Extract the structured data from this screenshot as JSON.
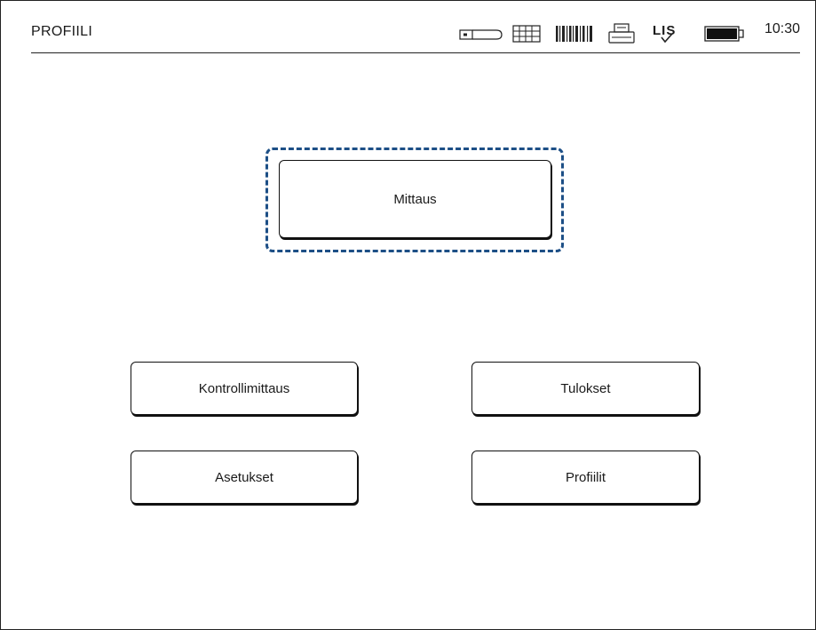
{
  "header": {
    "title": "PROFIILI",
    "time": "10:30",
    "lis_label": "LIS",
    "icons": [
      "usb-stick-icon",
      "keyboard-icon",
      "barcode-icon",
      "printer-icon",
      "lis-icon",
      "battery-icon"
    ]
  },
  "main": {
    "primary_button": "Mittaus",
    "buttons": {
      "control": "Kontrollimittaus",
      "results": "Tulokset",
      "settings": "Asetukset",
      "profiles": "Profiilit"
    }
  },
  "colors": {
    "focus": "#1d4f86",
    "outline": "#111111",
    "background": "#ffffff"
  }
}
